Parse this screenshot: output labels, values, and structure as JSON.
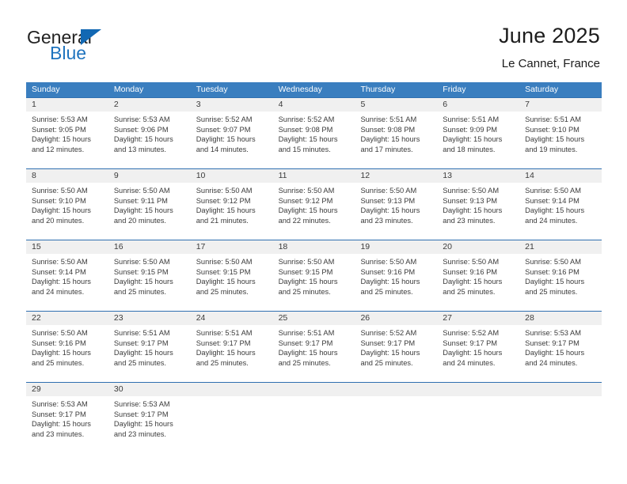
{
  "brand": {
    "name_part1": "General",
    "name_part2": "Blue",
    "accent_color": "#1268b3"
  },
  "header": {
    "title": "June 2025",
    "subtitle": "Le Cannet, France"
  },
  "weekdays": [
    "Sunday",
    "Monday",
    "Tuesday",
    "Wednesday",
    "Thursday",
    "Friday",
    "Saturday"
  ],
  "colors": {
    "header_band": "#3a7ebf",
    "daynum_band": "#f0f0f0",
    "row_divider": "#2f6fb0",
    "text": "#3b3b3b"
  },
  "weeks": [
    [
      {
        "day": "1",
        "sunrise": "Sunrise: 5:53 AM",
        "sunset": "Sunset: 9:05 PM",
        "daylight_line1": "Daylight: 15 hours",
        "daylight_line2": "and 12 minutes."
      },
      {
        "day": "2",
        "sunrise": "Sunrise: 5:53 AM",
        "sunset": "Sunset: 9:06 PM",
        "daylight_line1": "Daylight: 15 hours",
        "daylight_line2": "and 13 minutes."
      },
      {
        "day": "3",
        "sunrise": "Sunrise: 5:52 AM",
        "sunset": "Sunset: 9:07 PM",
        "daylight_line1": "Daylight: 15 hours",
        "daylight_line2": "and 14 minutes."
      },
      {
        "day": "4",
        "sunrise": "Sunrise: 5:52 AM",
        "sunset": "Sunset: 9:08 PM",
        "daylight_line1": "Daylight: 15 hours",
        "daylight_line2": "and 15 minutes."
      },
      {
        "day": "5",
        "sunrise": "Sunrise: 5:51 AM",
        "sunset": "Sunset: 9:08 PM",
        "daylight_line1": "Daylight: 15 hours",
        "daylight_line2": "and 17 minutes."
      },
      {
        "day": "6",
        "sunrise": "Sunrise: 5:51 AM",
        "sunset": "Sunset: 9:09 PM",
        "daylight_line1": "Daylight: 15 hours",
        "daylight_line2": "and 18 minutes."
      },
      {
        "day": "7",
        "sunrise": "Sunrise: 5:51 AM",
        "sunset": "Sunset: 9:10 PM",
        "daylight_line1": "Daylight: 15 hours",
        "daylight_line2": "and 19 minutes."
      }
    ],
    [
      {
        "day": "8",
        "sunrise": "Sunrise: 5:50 AM",
        "sunset": "Sunset: 9:10 PM",
        "daylight_line1": "Daylight: 15 hours",
        "daylight_line2": "and 20 minutes."
      },
      {
        "day": "9",
        "sunrise": "Sunrise: 5:50 AM",
        "sunset": "Sunset: 9:11 PM",
        "daylight_line1": "Daylight: 15 hours",
        "daylight_line2": "and 20 minutes."
      },
      {
        "day": "10",
        "sunrise": "Sunrise: 5:50 AM",
        "sunset": "Sunset: 9:12 PM",
        "daylight_line1": "Daylight: 15 hours",
        "daylight_line2": "and 21 minutes."
      },
      {
        "day": "11",
        "sunrise": "Sunrise: 5:50 AM",
        "sunset": "Sunset: 9:12 PM",
        "daylight_line1": "Daylight: 15 hours",
        "daylight_line2": "and 22 minutes."
      },
      {
        "day": "12",
        "sunrise": "Sunrise: 5:50 AM",
        "sunset": "Sunset: 9:13 PM",
        "daylight_line1": "Daylight: 15 hours",
        "daylight_line2": "and 23 minutes."
      },
      {
        "day": "13",
        "sunrise": "Sunrise: 5:50 AM",
        "sunset": "Sunset: 9:13 PM",
        "daylight_line1": "Daylight: 15 hours",
        "daylight_line2": "and 23 minutes."
      },
      {
        "day": "14",
        "sunrise": "Sunrise: 5:50 AM",
        "sunset": "Sunset: 9:14 PM",
        "daylight_line1": "Daylight: 15 hours",
        "daylight_line2": "and 24 minutes."
      }
    ],
    [
      {
        "day": "15",
        "sunrise": "Sunrise: 5:50 AM",
        "sunset": "Sunset: 9:14 PM",
        "daylight_line1": "Daylight: 15 hours",
        "daylight_line2": "and 24 minutes."
      },
      {
        "day": "16",
        "sunrise": "Sunrise: 5:50 AM",
        "sunset": "Sunset: 9:15 PM",
        "daylight_line1": "Daylight: 15 hours",
        "daylight_line2": "and 25 minutes."
      },
      {
        "day": "17",
        "sunrise": "Sunrise: 5:50 AM",
        "sunset": "Sunset: 9:15 PM",
        "daylight_line1": "Daylight: 15 hours",
        "daylight_line2": "and 25 minutes."
      },
      {
        "day": "18",
        "sunrise": "Sunrise: 5:50 AM",
        "sunset": "Sunset: 9:15 PM",
        "daylight_line1": "Daylight: 15 hours",
        "daylight_line2": "and 25 minutes."
      },
      {
        "day": "19",
        "sunrise": "Sunrise: 5:50 AM",
        "sunset": "Sunset: 9:16 PM",
        "daylight_line1": "Daylight: 15 hours",
        "daylight_line2": "and 25 minutes."
      },
      {
        "day": "20",
        "sunrise": "Sunrise: 5:50 AM",
        "sunset": "Sunset: 9:16 PM",
        "daylight_line1": "Daylight: 15 hours",
        "daylight_line2": "and 25 minutes."
      },
      {
        "day": "21",
        "sunrise": "Sunrise: 5:50 AM",
        "sunset": "Sunset: 9:16 PM",
        "daylight_line1": "Daylight: 15 hours",
        "daylight_line2": "and 25 minutes."
      }
    ],
    [
      {
        "day": "22",
        "sunrise": "Sunrise: 5:50 AM",
        "sunset": "Sunset: 9:16 PM",
        "daylight_line1": "Daylight: 15 hours",
        "daylight_line2": "and 25 minutes."
      },
      {
        "day": "23",
        "sunrise": "Sunrise: 5:51 AM",
        "sunset": "Sunset: 9:17 PM",
        "daylight_line1": "Daylight: 15 hours",
        "daylight_line2": "and 25 minutes."
      },
      {
        "day": "24",
        "sunrise": "Sunrise: 5:51 AM",
        "sunset": "Sunset: 9:17 PM",
        "daylight_line1": "Daylight: 15 hours",
        "daylight_line2": "and 25 minutes."
      },
      {
        "day": "25",
        "sunrise": "Sunrise: 5:51 AM",
        "sunset": "Sunset: 9:17 PM",
        "daylight_line1": "Daylight: 15 hours",
        "daylight_line2": "and 25 minutes."
      },
      {
        "day": "26",
        "sunrise": "Sunrise: 5:52 AM",
        "sunset": "Sunset: 9:17 PM",
        "daylight_line1": "Daylight: 15 hours",
        "daylight_line2": "and 25 minutes."
      },
      {
        "day": "27",
        "sunrise": "Sunrise: 5:52 AM",
        "sunset": "Sunset: 9:17 PM",
        "daylight_line1": "Daylight: 15 hours",
        "daylight_line2": "and 24 minutes."
      },
      {
        "day": "28",
        "sunrise": "Sunrise: 5:53 AM",
        "sunset": "Sunset: 9:17 PM",
        "daylight_line1": "Daylight: 15 hours",
        "daylight_line2": "and 24 minutes."
      }
    ],
    [
      {
        "day": "29",
        "sunrise": "Sunrise: 5:53 AM",
        "sunset": "Sunset: 9:17 PM",
        "daylight_line1": "Daylight: 15 hours",
        "daylight_line2": "and 23 minutes."
      },
      {
        "day": "30",
        "sunrise": "Sunrise: 5:53 AM",
        "sunset": "Sunset: 9:17 PM",
        "daylight_line1": "Daylight: 15 hours",
        "daylight_line2": "and 23 minutes."
      },
      {
        "day": "",
        "sunrise": "",
        "sunset": "",
        "daylight_line1": "",
        "daylight_line2": ""
      },
      {
        "day": "",
        "sunrise": "",
        "sunset": "",
        "daylight_line1": "",
        "daylight_line2": ""
      },
      {
        "day": "",
        "sunrise": "",
        "sunset": "",
        "daylight_line1": "",
        "daylight_line2": ""
      },
      {
        "day": "",
        "sunrise": "",
        "sunset": "",
        "daylight_line1": "",
        "daylight_line2": ""
      },
      {
        "day": "",
        "sunrise": "",
        "sunset": "",
        "daylight_line1": "",
        "daylight_line2": ""
      }
    ]
  ]
}
